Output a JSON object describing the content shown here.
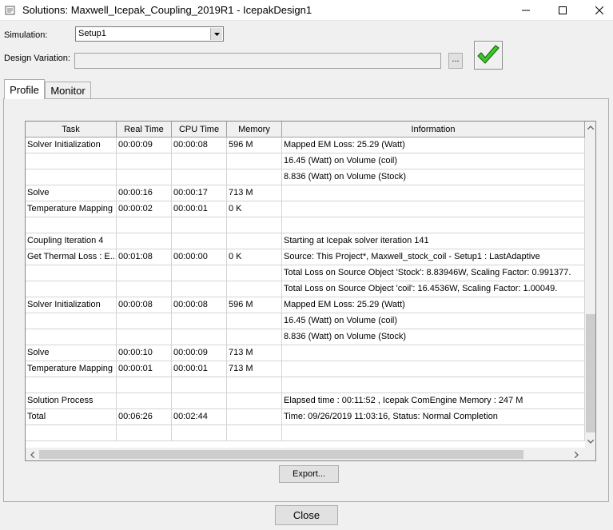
{
  "window": {
    "title": "Solutions: Maxwell_Icepak_Coupling_2019R1 - IcepakDesign1"
  },
  "simulation": {
    "label": "Simulation:",
    "selected": "Setup1"
  },
  "design_variation": {
    "label": "Design Variation:",
    "value": "",
    "browse_label": "..."
  },
  "tabs": [
    {
      "label": "Profile",
      "selected": true
    },
    {
      "label": "Monitor",
      "selected": false
    }
  ],
  "table": {
    "headers": [
      "Task",
      "Real Time",
      "CPU Time",
      "Memory",
      "Information"
    ],
    "rows": [
      [
        "Solver Initialization",
        "00:00:09",
        "00:00:08",
        "596 M",
        "Mapped EM Loss: 25.29 (Watt)"
      ],
      [
        "",
        "",
        "",
        "",
        "16.45 (Watt) on Volume (coil)"
      ],
      [
        "",
        "",
        "",
        "",
        "8.836 (Watt) on Volume (Stock)"
      ],
      [
        "Solve",
        "00:00:16",
        "00:00:17",
        "713 M",
        ""
      ],
      [
        "Temperature Mapping",
        "00:00:02",
        "00:00:01",
        "0 K",
        ""
      ],
      [
        "",
        "",
        "",
        "",
        ""
      ],
      [
        "Coupling Iteration 4",
        "",
        "",
        "",
        "Starting at Icepak solver iteration 141"
      ],
      [
        "Get Thermal Loss : E...",
        "00:01:08",
        "00:00:00",
        "0 K",
        "Source: This Project*, Maxwell_stock_coil - Setup1 : LastAdaptive"
      ],
      [
        "",
        "",
        "",
        "",
        "Total Loss on Source Object 'Stock': 8.83946W, Scaling Factor: 0.991377."
      ],
      [
        "",
        "",
        "",
        "",
        "Total Loss on Source Object 'coil': 16.4536W, Scaling Factor: 1.00049."
      ],
      [
        "Solver Initialization",
        "00:00:08",
        "00:00:08",
        "596 M",
        "Mapped EM Loss: 25.29 (Watt)"
      ],
      [
        "",
        "",
        "",
        "",
        "16.45 (Watt) on Volume (coil)"
      ],
      [
        "",
        "",
        "",
        "",
        "8.836 (Watt) on Volume (Stock)"
      ],
      [
        "Solve",
        "00:00:10",
        "00:00:09",
        "713 M",
        ""
      ],
      [
        "Temperature Mapping",
        "00:00:01",
        "00:00:01",
        "713 M",
        ""
      ],
      [
        "",
        "",
        "",
        "",
        ""
      ],
      [
        "Solution Process",
        "",
        "",
        "",
        "Elapsed time : 00:11:52 , Icepak ComEngine Memory : 247 M"
      ],
      [
        "Total",
        "00:06:26",
        "00:02:44",
        "",
        "Time:  09/26/2019 11:03:16, Status: Normal Completion"
      ],
      [
        "",
        "",
        "",
        "",
        ""
      ]
    ]
  },
  "buttons": {
    "export_label": "Export...",
    "close_label": "Close"
  },
  "colors": {
    "check_green": "#3cc82a",
    "window_bg": "#f0f0f0"
  }
}
